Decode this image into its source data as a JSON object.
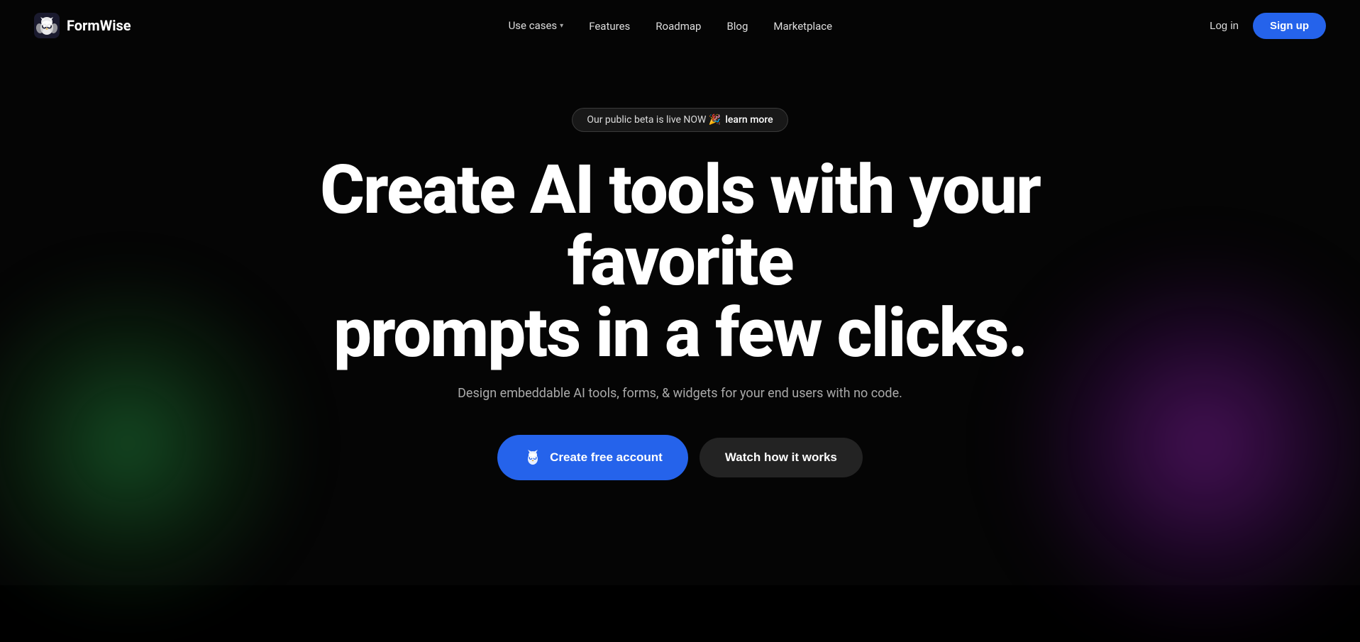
{
  "brand": {
    "logo_text": "FormWise",
    "logo_alt": "FormWise logo"
  },
  "nav": {
    "links": [
      {
        "label": "Use cases",
        "has_dropdown": true,
        "id": "use-cases"
      },
      {
        "label": "Features",
        "has_dropdown": false,
        "id": "features"
      },
      {
        "label": "Roadmap",
        "has_dropdown": false,
        "id": "roadmap"
      },
      {
        "label": "Blog",
        "has_dropdown": false,
        "id": "blog"
      },
      {
        "label": "Marketplace",
        "has_dropdown": false,
        "id": "marketplace"
      }
    ],
    "login_label": "Log in",
    "signup_label": "Sign up"
  },
  "hero": {
    "beta_badge": "Our public beta is live NOW 🎉",
    "learn_more": "learn more",
    "headline_line1": "Create AI tools with your favorite",
    "headline_line2": "prompts in a few clicks.",
    "subheadline": "Design embeddable AI tools, forms, & widgets for your end users with no code.",
    "cta_primary": "Create free account",
    "cta_secondary": "Watch how it works"
  }
}
